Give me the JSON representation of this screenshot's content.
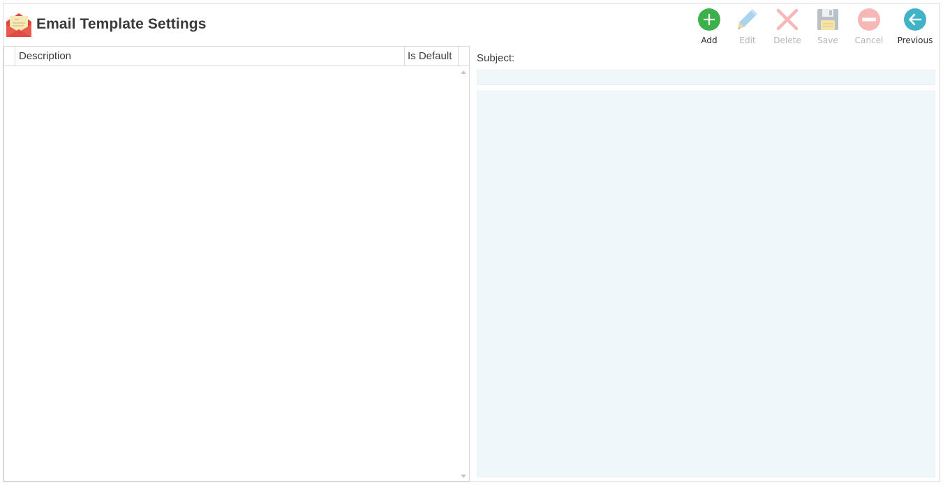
{
  "header": {
    "title": "Email Template Settings",
    "icon": "envelope-letter-icon"
  },
  "toolbar": {
    "buttons": [
      {
        "id": "add",
        "label": "Add",
        "icon": "plus-circle-icon",
        "enabled": true,
        "color": "#3cb04a"
      },
      {
        "id": "edit",
        "label": "Edit",
        "icon": "pencil-icon",
        "enabled": false,
        "color": "#a8d4ee"
      },
      {
        "id": "delete",
        "label": "Delete",
        "icon": "x-icon",
        "enabled": false,
        "color": "#f8b8b8"
      },
      {
        "id": "save",
        "label": "Save",
        "icon": "floppy-disk-icon",
        "enabled": false,
        "color": "#b9c0c8"
      },
      {
        "id": "cancel",
        "label": "Cancel",
        "icon": "minus-circle-icon",
        "enabled": false,
        "color": "#f7b7b7"
      },
      {
        "id": "previous",
        "label": "Previous",
        "icon": "arrow-left-circle-icon",
        "enabled": true,
        "color": "#3fb4c6"
      }
    ]
  },
  "grid": {
    "columns": [
      {
        "label": "Description"
      },
      {
        "label": "Is Default"
      }
    ],
    "rows": []
  },
  "editor": {
    "subject_label": "Subject:",
    "subject_value": "",
    "body_value": ""
  },
  "colors": {
    "field_background": "#f0f7fb",
    "border": "#d9d9d9"
  }
}
